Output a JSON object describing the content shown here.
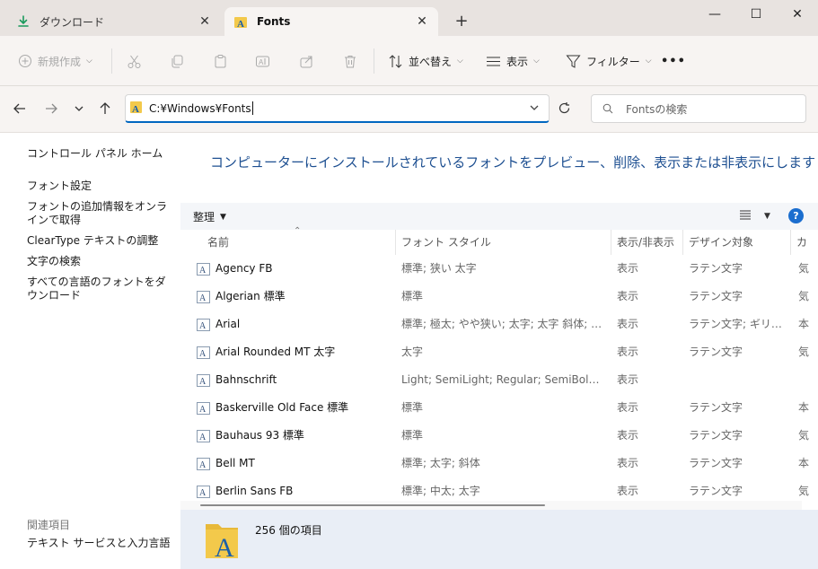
{
  "tabs": [
    {
      "label": "ダウンロード",
      "close": "✕"
    },
    {
      "label": "Fonts",
      "close": "✕"
    }
  ],
  "new_tab": "+",
  "window_controls": {
    "minimize": "—",
    "maximize": "☐",
    "close": "✕"
  },
  "command_bar": {
    "new_label": "新規作成",
    "sort_label": "並べ替え",
    "view_label": "表示",
    "filter_label": "フィルター",
    "more_label": "•••"
  },
  "address": {
    "path": "C:¥Windows¥Fonts",
    "search_placeholder": "Fontsの検索"
  },
  "left_pane": {
    "links": [
      "コントロール パネル ホーム",
      "フォント設定",
      "フォントの追加情報をオンラインで取得",
      "ClearType テキストの調整",
      "文字の検索",
      "すべての言語のフォントをダウンロード"
    ],
    "related_title": "関連項目",
    "related_links": [
      "テキスト サービスと入力言語"
    ]
  },
  "main": {
    "heading": "コンピューターにインストールされているフォントをプレビュー、削除、表示または非表示にします",
    "organize_label": "整理",
    "help_label": "?"
  },
  "table": {
    "columns": [
      "名前",
      "フォント スタイル",
      "表示/非表示",
      "デザイン対象",
      "カ"
    ],
    "rows": [
      {
        "name": "Agency FB",
        "style": "標準; 狭い 太字",
        "show": "表示",
        "design": "ラテン文字",
        "cat": "気"
      },
      {
        "name": "Algerian 標準",
        "style": "標準",
        "show": "表示",
        "design": "ラテン文字",
        "cat": "気"
      },
      {
        "name": "Arial",
        "style": "標準; 極太; やや狭い; 太字; 太字 斜体; 斜…",
        "show": "表示",
        "design": "ラテン文字; ギリシャ…",
        "cat": "本"
      },
      {
        "name": "Arial Rounded MT 太字",
        "style": "太字",
        "show": "表示",
        "design": "ラテン文字",
        "cat": "気"
      },
      {
        "name": "Bahnschrift",
        "style": "Light; SemiLight; Regular; SemiBold; Ligh…",
        "show": "表示",
        "design": "",
        "cat": ""
      },
      {
        "name": "Baskerville Old Face 標準",
        "style": "標準",
        "show": "表示",
        "design": "ラテン文字",
        "cat": "本"
      },
      {
        "name": "Bauhaus 93 標準",
        "style": "標準",
        "show": "表示",
        "design": "ラテン文字",
        "cat": "気"
      },
      {
        "name": "Bell MT",
        "style": "標準; 太字; 斜体",
        "show": "表示",
        "design": "ラテン文字",
        "cat": "本"
      },
      {
        "name": "Berlin Sans FB",
        "style": "標準; 中太; 太字",
        "show": "表示",
        "design": "ラテン文字",
        "cat": "気"
      }
    ]
  },
  "status": {
    "item_count": "256 個の項目"
  },
  "colors": {
    "accent": "#0067c0",
    "heading": "#1d4f91",
    "details_bg": "#e9eef6",
    "help": "#1b6ecf"
  }
}
